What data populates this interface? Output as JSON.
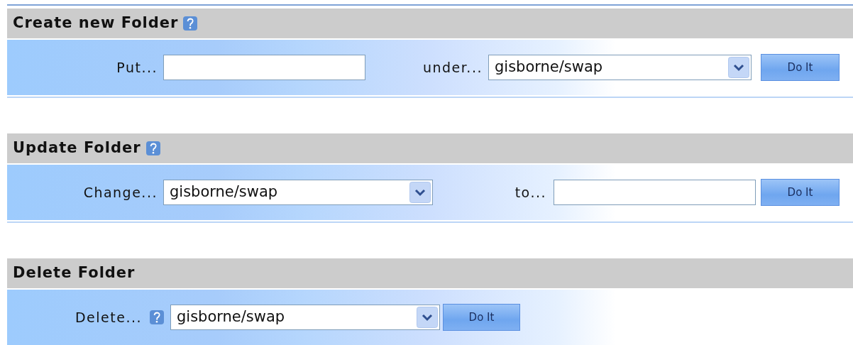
{
  "sections": [
    {
      "title": "Create new Folder",
      "help_icon": true,
      "fields": [
        {
          "kind": "label",
          "text": "Put..."
        },
        {
          "kind": "input"
        },
        {
          "kind": "label",
          "text": "under..."
        },
        {
          "kind": "select",
          "value": "gisborne/swap"
        },
        {
          "kind": "button",
          "label": "Do It"
        }
      ]
    },
    {
      "title": "Update Folder",
      "help_icon": true,
      "fields": [
        {
          "kind": "label",
          "text": "Change..."
        },
        {
          "kind": "select",
          "value": "gisborne/swap"
        },
        {
          "kind": "label",
          "text": "to..."
        },
        {
          "kind": "input"
        },
        {
          "kind": "button",
          "label": "Do It"
        }
      ]
    },
    {
      "title": "Delete Folder",
      "help_icon": false,
      "fields": [
        {
          "kind": "label",
          "text": "Delete..."
        },
        {
          "kind": "help"
        },
        {
          "kind": "select",
          "value": "gisborne/swap"
        },
        {
          "kind": "button",
          "label": "Do It"
        }
      ]
    }
  ]
}
